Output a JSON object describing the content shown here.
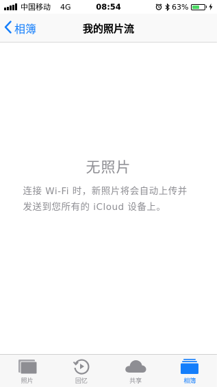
{
  "status_bar": {
    "carrier": "中国移动",
    "network": "4G",
    "time": "08:54",
    "battery_percent": "63%",
    "battery_level": 0.63,
    "battery_color": "#4cd964"
  },
  "nav": {
    "back_label": "相簿",
    "title": "我的照片流",
    "accent_color": "#147efb"
  },
  "empty_state": {
    "title": "无照片",
    "message": "连接 Wi-Fi 时，新照片将会自动上传并发送到您所有的 iCloud 设备上。"
  },
  "tab_bar": {
    "tabs": [
      {
        "label": "照片",
        "icon": "photos-icon",
        "active": false
      },
      {
        "label": "回忆",
        "icon": "memories-icon",
        "active": false
      },
      {
        "label": "共享",
        "icon": "cloud-icon",
        "active": false
      },
      {
        "label": "相簿",
        "icon": "albums-icon",
        "active": true
      }
    ]
  }
}
